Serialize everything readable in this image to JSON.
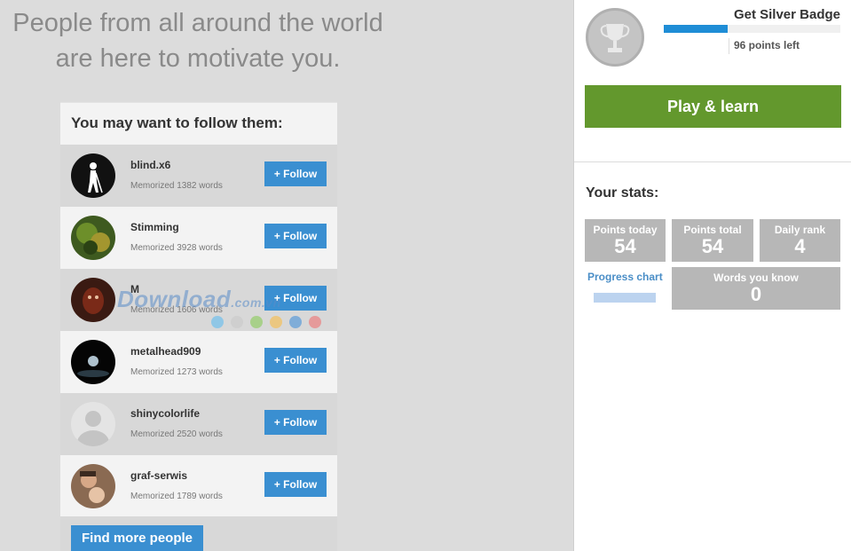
{
  "headline": {
    "line1": "People from all around the world",
    "line2": "are here to motivate you."
  },
  "follow_panel": {
    "title": "You may want to follow them:",
    "follow_label": "+ Follow",
    "users": [
      {
        "name": "blind.x6",
        "memorized": "Memorized 1382 words"
      },
      {
        "name": "Stimming",
        "memorized": "Memorized 3928 words"
      },
      {
        "name": "M",
        "memorized": "Memorized 1606 words"
      },
      {
        "name": "metalhead909",
        "memorized": "Memorized 1273 words"
      },
      {
        "name": "shinycolorlife",
        "memorized": "Memorized 2520 words"
      },
      {
        "name": "graf-serwis",
        "memorized": "Memorized 1789 words"
      }
    ],
    "find_more": "Find more people"
  },
  "watermark": {
    "text": "Download",
    "suffix": ".com.vn"
  },
  "badge": {
    "title": "Get Silver Badge",
    "progress_fraction": 0.36,
    "points_left": "96 points left"
  },
  "play_button": "Play & learn",
  "stats": {
    "title": "Your stats:",
    "points_today": {
      "label": "Points today",
      "value": "54"
    },
    "points_total": {
      "label": "Points total",
      "value": "54"
    },
    "daily_rank": {
      "label": "Daily rank",
      "value": "4"
    },
    "progress_chart": "Progress chart",
    "words_known": {
      "label": "Words you know",
      "value": "0"
    }
  },
  "colors": {
    "accent_blue": "#3a8fd1",
    "play_green": "#63982d",
    "stat_gray": "#b7b7b7"
  }
}
